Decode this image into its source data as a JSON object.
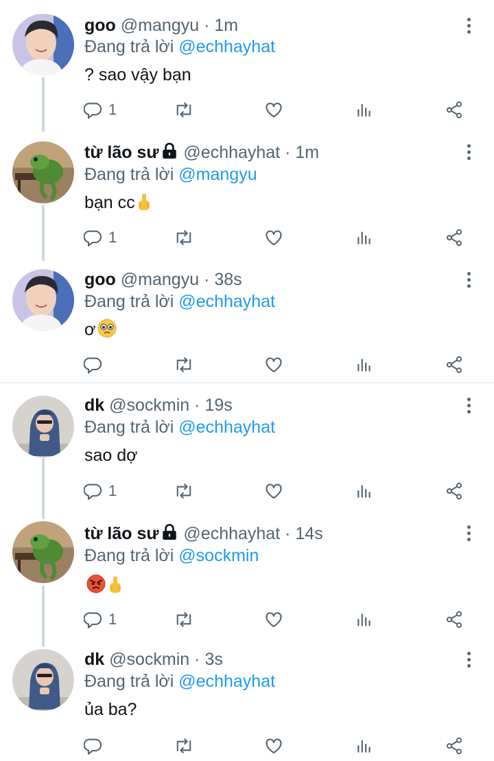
{
  "reply_prefix": "Đang trả lời",
  "colors": {
    "link": "#1d9bf0",
    "secondary": "#536471",
    "text": "#0f1419"
  },
  "tweets": [
    {
      "name": "goo",
      "handle": "@mangyu",
      "time": "· 1m",
      "reply_to": "@echhayhat",
      "text": "? sao vậy bạn",
      "reply_count": "1",
      "avatar": "person-avatar",
      "locked": false,
      "emoji": []
    },
    {
      "name": "từ lão sư",
      "handle": "@echhayhat",
      "time": "· 1m",
      "reply_to": "@mangyu",
      "text": "bạn cc",
      "reply_count": "1",
      "avatar": "frog-avatar",
      "locked": true,
      "emoji": [
        "middle-finger-emoji"
      ]
    },
    {
      "name": "goo",
      "handle": "@mangyu",
      "time": "· 38s",
      "reply_to": "@echhayhat",
      "text": "ơ",
      "reply_count": "",
      "avatar": "person-avatar",
      "locked": false,
      "emoji": [
        "pleading-face-emoji"
      ]
    },
    {
      "name": "dk",
      "handle": "@sockmin",
      "time": "· 19s",
      "reply_to": "@echhayhat",
      "text": "sao dợ",
      "reply_count": "1",
      "avatar": "hooded-person-avatar",
      "locked": false,
      "emoji": []
    },
    {
      "name": "từ lão sư",
      "handle": "@echhayhat",
      "time": "· 14s",
      "reply_to": "@sockmin",
      "text": "",
      "reply_count": "1",
      "avatar": "frog-avatar",
      "locked": true,
      "emoji": [
        "angry-face-emoji",
        "middle-finger-emoji"
      ]
    },
    {
      "name": "dk",
      "handle": "@sockmin",
      "time": "· 3s",
      "reply_to": "@echhayhat",
      "text": "ủa ba?",
      "reply_count": "",
      "avatar": "hooded-person-avatar",
      "locked": false,
      "emoji": []
    }
  ]
}
